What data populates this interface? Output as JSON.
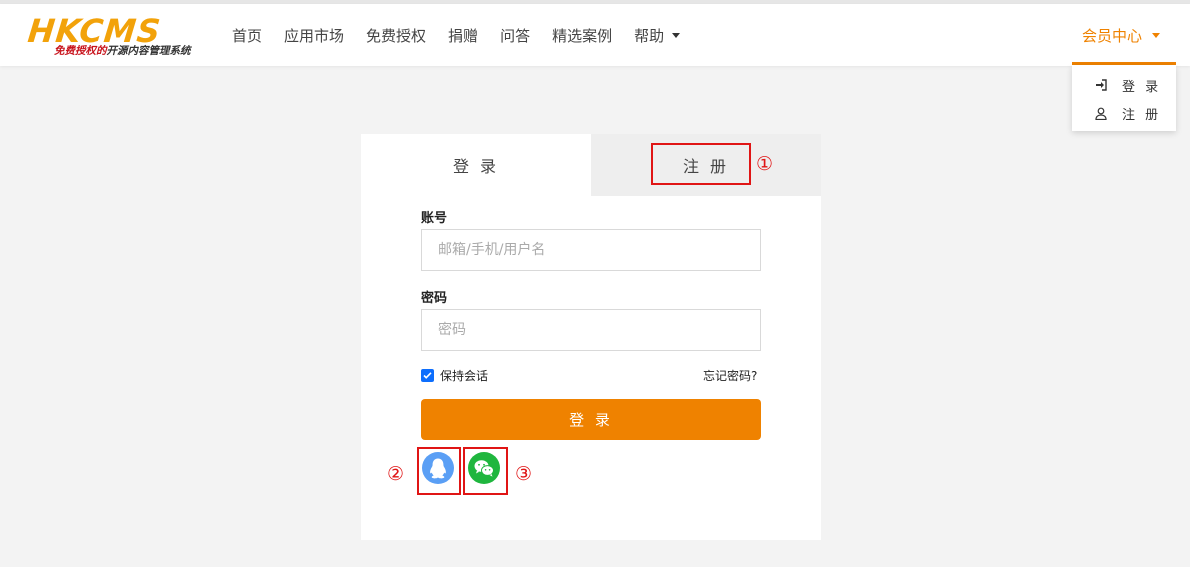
{
  "header": {
    "logo_main": "HKCMS",
    "logo_sub_red": "免费授权的",
    "logo_sub_rest": "开源内容管理系统",
    "nav": [
      {
        "label": "首页"
      },
      {
        "label": "应用市场"
      },
      {
        "label": "免费授权"
      },
      {
        "label": "捐赠"
      },
      {
        "label": "问答"
      },
      {
        "label": "精选案例"
      },
      {
        "label": "帮助",
        "has_caret": true
      }
    ],
    "member_center": "会员中心",
    "accent_color": "#ef8200"
  },
  "dropdown": {
    "items": [
      {
        "label": "登 录",
        "icon": "sign-in-icon"
      },
      {
        "label": "注 册",
        "icon": "user-icon"
      }
    ]
  },
  "card": {
    "tabs": [
      {
        "label": "登 录",
        "active": true
      },
      {
        "label": "注 册",
        "active": false
      }
    ],
    "account": {
      "label": "账号",
      "placeholder": "邮箱/手机/用户名",
      "value": ""
    },
    "password": {
      "label": "密码",
      "placeholder": "密码",
      "value": ""
    },
    "remember": {
      "label": "保持会话",
      "checked": true
    },
    "forgot": "忘记密码?",
    "login_button": "登 录",
    "social": [
      {
        "name": "qq",
        "icon": "qq-icon",
        "color": "#5a9ff5"
      },
      {
        "name": "wechat",
        "icon": "wechat-icon",
        "color": "#1fb63e"
      }
    ]
  },
  "annotations": [
    "①",
    "②",
    "③"
  ]
}
